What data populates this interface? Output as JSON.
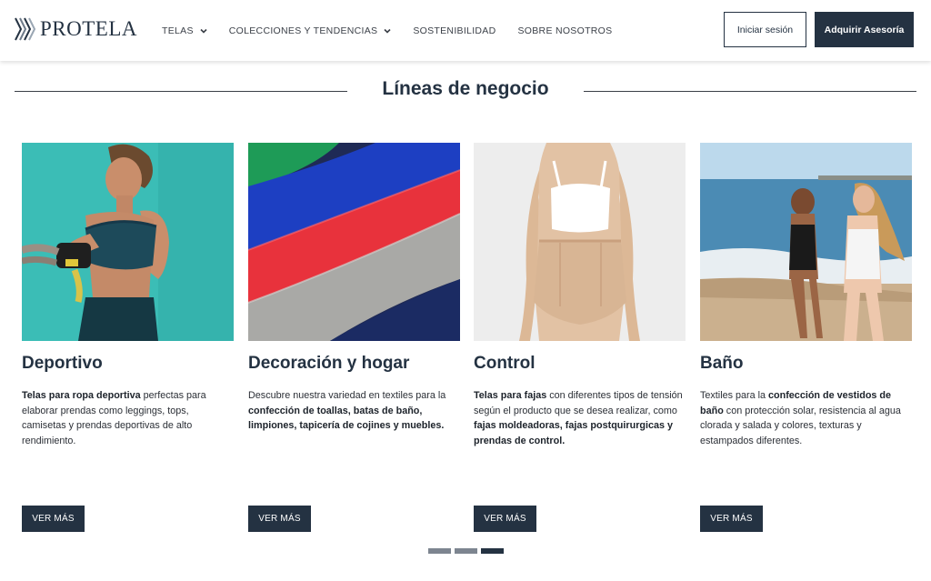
{
  "header": {
    "logo_text": "PROTELA",
    "nav": [
      {
        "label": "TELAS",
        "has_dropdown": true
      },
      {
        "label": "COLECCIONES Y TENDENCIAS",
        "has_dropdown": true
      },
      {
        "label": "SOSTENIBILIDAD",
        "has_dropdown": false
      },
      {
        "label": "SOBRE NOSOTROS",
        "has_dropdown": false
      }
    ],
    "login_label": "Iniciar sesión",
    "advice_label": "Adquirir Asesoría"
  },
  "section": {
    "title": "Líneas de negocio"
  },
  "cards": [
    {
      "title": "Deportivo",
      "desc_parts": [
        {
          "text": "Telas para ropa deportiva",
          "bold": true
        },
        {
          "text": " perfectas para elaborar prendas como leggings, tops, camisetas y prendas deportivas de alto rendimiento.",
          "bold": false
        }
      ],
      "button": "VER MÁS",
      "image": "athlete-woman-ropes-photo"
    },
    {
      "title": "Decoración y hogar",
      "desc_parts": [
        {
          "text": " Descubre nuestra variedad en textiles para la ",
          "bold": false
        },
        {
          "text": "confección de toallas, batas de baño, limpiones, tapicería de cojines y muebles.",
          "bold": true
        }
      ],
      "button": "VER MÁS",
      "image": "colored-towels-photo"
    },
    {
      "title": "Control",
      "desc_parts": [
        {
          "text": "Telas para fajas",
          "bold": true
        },
        {
          "text": " con diferentes tipos de tensión según el producto que se desea realizar, como ",
          "bold": false
        },
        {
          "text": "fajas moldeadoras, fajas postquirurgicas y prendas de control.",
          "bold": true
        }
      ],
      "button": "VER MÁS",
      "image": "shapewear-photo"
    },
    {
      "title": "Baño",
      "desc_parts": [
        {
          "text": "Textiles para la ",
          "bold": false
        },
        {
          "text": "confección de vestidos de baño",
          "bold": true
        },
        {
          "text": " con protección solar, resistencia al agua clorada y salada y colores, texturas y estampados diferentes.",
          "bold": false
        }
      ],
      "button": "VER MÁS",
      "image": "beach-swimwear-photo"
    }
  ],
  "pagination": {
    "pages": 3,
    "active": 3
  },
  "colors": {
    "brand": "#243242",
    "accent_teal": "#3bbab5"
  }
}
